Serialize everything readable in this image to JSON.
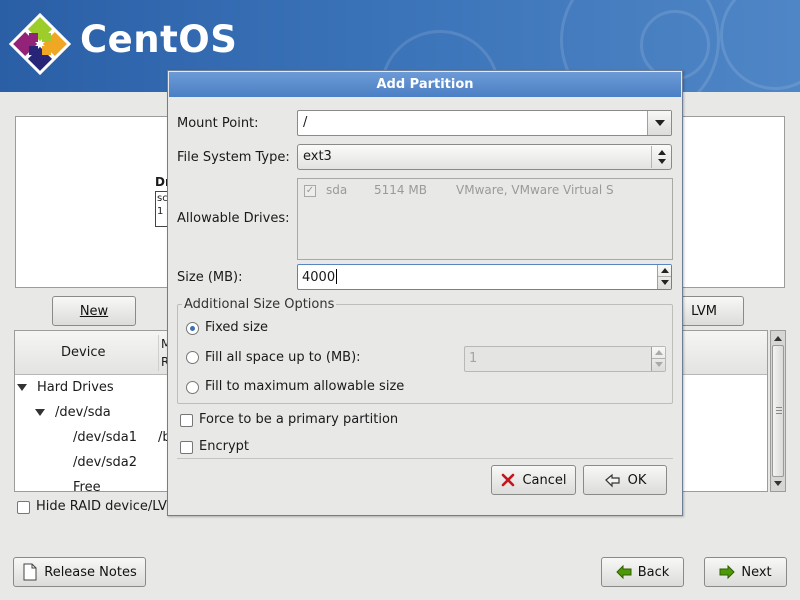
{
  "banner": {
    "logo_text": "CentOS"
  },
  "background": {
    "disk_graph": {
      "drive_label": "Dr",
      "drive_box_lines": [
        "sc",
        "1"
      ]
    },
    "buttons": {
      "new": "New",
      "lvm": "LVM"
    },
    "tree": {
      "columns": {
        "device": "Device",
        "mount_line1": "M",
        "mount_line2": "R"
      },
      "rows": [
        {
          "label": "Hard Drives",
          "mount": ""
        },
        {
          "label": "/dev/sda",
          "mount": ""
        },
        {
          "label": "/dev/sda1",
          "mount": "/b"
        },
        {
          "label": "/dev/sda2",
          "mount": ""
        },
        {
          "label": "Free",
          "mount": ""
        }
      ]
    },
    "hide_raid_label": "Hide RAID device/LV",
    "release_notes": "Release Notes",
    "back": "Back",
    "next": "Next"
  },
  "dialog": {
    "title": "Add Partition",
    "mount_point": {
      "label": "Mount Point:",
      "value": "/"
    },
    "fs_type": {
      "label": "File System Type:",
      "value": "ext3"
    },
    "allowable_drives": {
      "label": "Allowable Drives:",
      "drives": [
        {
          "checked": true,
          "name": "sda",
          "size": "5114 MB",
          "model": "VMware, VMware Virtual S"
        }
      ]
    },
    "size": {
      "label": "Size (MB):",
      "value": "4000"
    },
    "additional_size_options": {
      "title": "Additional Size Options",
      "fixed_size": "Fixed size",
      "fill_up_to": "Fill all space up to (MB):",
      "fill_up_to_value": "1",
      "fill_max": "Fill to maximum allowable size",
      "selected": "fixed_size"
    },
    "force_primary": {
      "label": "Force to be a primary partition",
      "checked": false
    },
    "encrypt": {
      "label": "Encrypt",
      "checked": false
    },
    "cancel": "Cancel",
    "ok": "OK"
  },
  "colors": {
    "banner": "#3a72b8",
    "dialog_title": "#5a8cd0",
    "selection": "#3f6fb8"
  }
}
